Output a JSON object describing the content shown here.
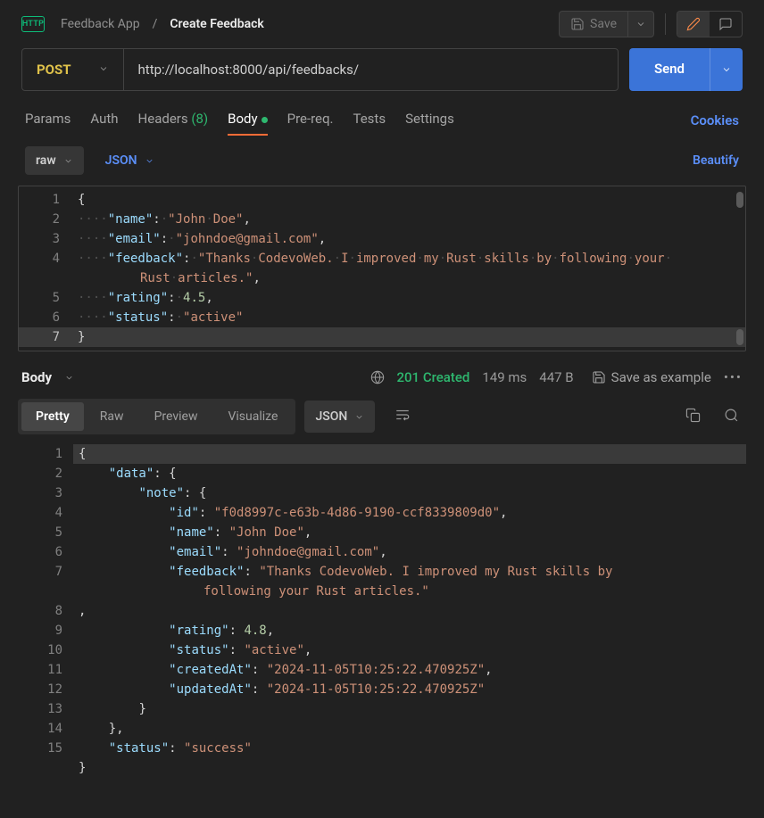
{
  "breadcrumb": {
    "parent": "Feedback App",
    "sep": "/",
    "current": "Create Feedback"
  },
  "httpBadge": "HTTP",
  "toolbar": {
    "save": "Save"
  },
  "request": {
    "method": "POST",
    "url": "http://localhost:8000/api/feedbacks/",
    "send": "Send"
  },
  "tabs": {
    "params": "Params",
    "auth": "Auth",
    "headers_label": "Headers",
    "headers_count": "(8)",
    "body": "Body",
    "prereq": "Pre-req.",
    "tests": "Tests",
    "settings": "Settings",
    "cookies": "Cookies"
  },
  "bodyOpts": {
    "raw": "raw",
    "json": "JSON",
    "beautify": "Beautify"
  },
  "reqPayload": {
    "name": "John Doe",
    "email": "johndoe@gmail.com",
    "feedback": "Thanks CodevoWeb. I improved my Rust skills by following your Rust articles.",
    "rating": 4.5,
    "status": "active"
  },
  "reqLineNumbers": [
    "1",
    "2",
    "3",
    "4",
    "5",
    "6",
    "7"
  ],
  "response": {
    "label": "Body",
    "status_code": "201",
    "status_text": "Created",
    "time": "149 ms",
    "size": "447 B",
    "saveExample": "Save as example"
  },
  "respView": {
    "pretty": "Pretty",
    "raw": "Raw",
    "preview": "Preview",
    "visualize": "Visualize",
    "json": "JSON"
  },
  "respPayload": {
    "data": {
      "note": {
        "id": "f0d8997c-e63b-4d86-9190-ccf8339809d0",
        "name": "John Doe",
        "email": "johndoe@gmail.com",
        "feedback": "Thanks CodevoWeb. I improved my Rust skills by following your Rust articles.",
        "rating": 4.8,
        "status": "active",
        "createdAt": "2024-11-05T10:25:22.470925Z",
        "updatedAt": "2024-11-05T10:25:22.470925Z"
      }
    },
    "status": "success"
  },
  "respLineNumbers": [
    "1",
    "2",
    "3",
    "4",
    "5",
    "6",
    "7",
    "8",
    "9",
    "10",
    "11",
    "12",
    "13",
    "14",
    "15"
  ]
}
